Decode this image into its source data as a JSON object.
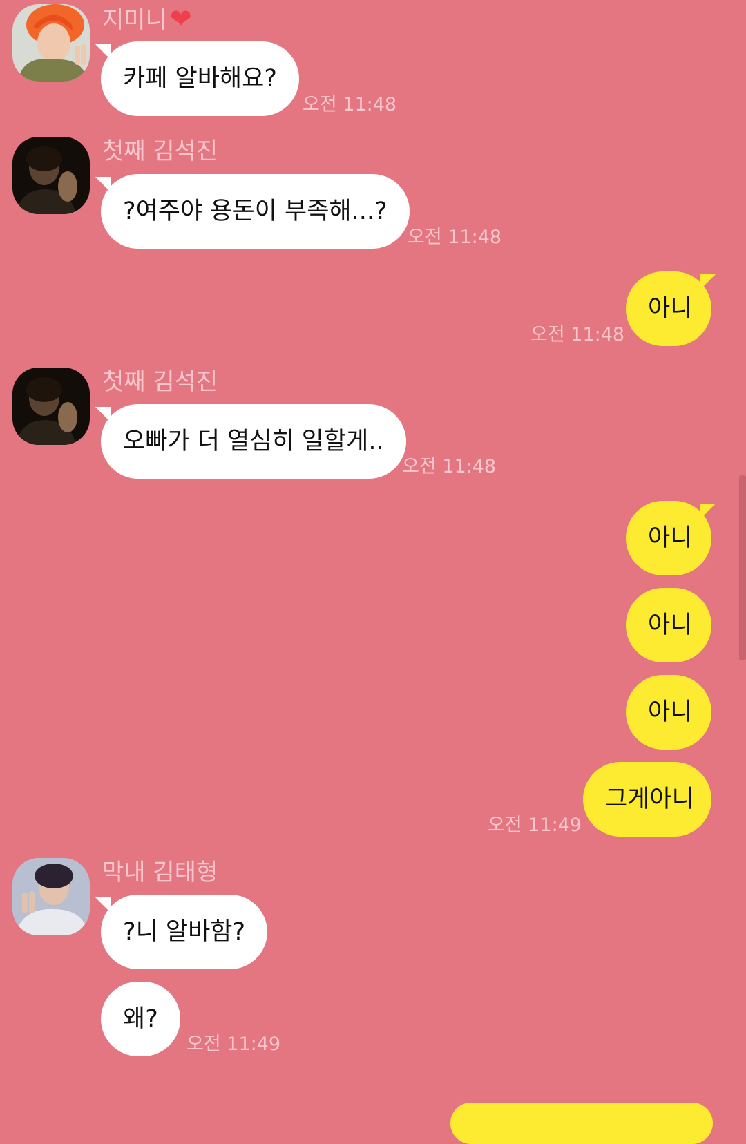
{
  "colors": {
    "background": "#e47682",
    "incoming_bubble": "#ffffff",
    "outgoing_bubble": "#fdeb31",
    "meta_text": "#f8c6cc",
    "heart": "#ef3e4c"
  },
  "messages": [
    {
      "sender": "지미니",
      "sender_icon": "heart-icon",
      "text": "카페 알바해요?",
      "time": "오전 11:48"
    },
    {
      "sender": "첫째 김석진",
      "text": "?여주야 용돈이 부족해...?",
      "time": "오전 11:48"
    },
    {
      "mine": true,
      "text": "아니",
      "time": "오전 11:48"
    },
    {
      "sender": "첫째 김석진",
      "text": "오빠가 더 열심히 일할게..",
      "time": "오전 11:48"
    },
    {
      "mine": true,
      "text": "아니"
    },
    {
      "mine": true,
      "text": "아니"
    },
    {
      "mine": true,
      "text": "아니"
    },
    {
      "mine": true,
      "text": "그게아니",
      "time": "오전 11:49"
    },
    {
      "sender": "막내 김태형",
      "text": "?니 알바함?"
    },
    {
      "text": "왜?",
      "time": "오전 11:49"
    }
  ]
}
